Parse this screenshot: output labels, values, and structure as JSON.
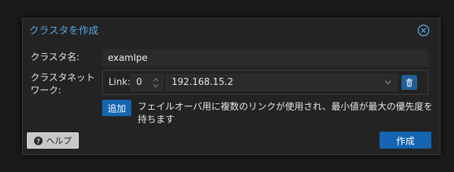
{
  "dialog": {
    "title": "クラスタを作成",
    "close_icon": "close-circle-icon"
  },
  "form": {
    "cluster_name_label": "クラスタ名:",
    "cluster_name_value": "examlpe",
    "network_label": "クラスタネットワーク:",
    "link_label": "Link:",
    "link_number": "0",
    "address_value": "192.168.15.2",
    "add_button": "追加",
    "hint_text": "フェイルオーバ用に複数のリンクが使用され、最小値が最大の優先度を持ちます"
  },
  "footer": {
    "help_label": "ヘルプ",
    "help_icon": "question-circle-icon",
    "create_label": "作成"
  },
  "colors": {
    "accent": "#1565b2",
    "title": "#5aa6e0"
  }
}
